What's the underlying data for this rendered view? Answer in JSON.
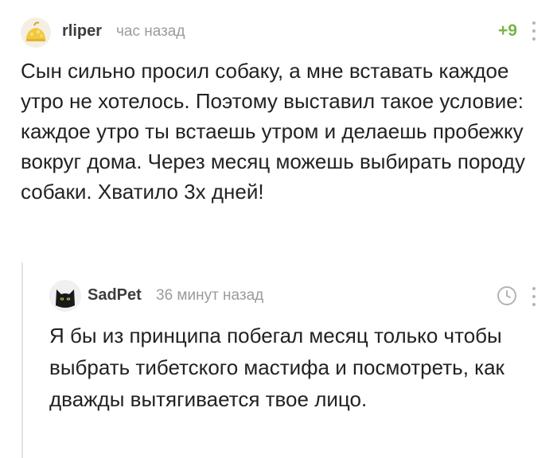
{
  "comment": {
    "author": "rliper",
    "time": "час назад",
    "rating": "+9",
    "text": "Сын сильно просил собаку, а мне вставать каждое утро не хотелось. Поэтому выставил такое условие: каждое утро ты встаешь утром и делаешь пробежку вокруг дома. Через месяц можешь выбирать породу собаки. Хватило 3х дней!",
    "avatar_icon": "yellow-cap-avatar-icon",
    "more_icon": "vertical-dots-icon"
  },
  "reply": {
    "author": "SadPet",
    "time": "36 минут назад",
    "text": "Я бы из принципа побегал месяц только чтобы выбрать тибетского мастифа и посмотреть, как дважды вытягивается твое лицо.",
    "avatar_icon": "black-cat-avatar-icon",
    "clock_icon": "clock-icon",
    "more_icon": "vertical-dots-icon"
  },
  "colors": {
    "rating": "#7ab446",
    "meta": "#9b9b9b",
    "text": "#222222",
    "thread_line": "#e3e3e3"
  }
}
